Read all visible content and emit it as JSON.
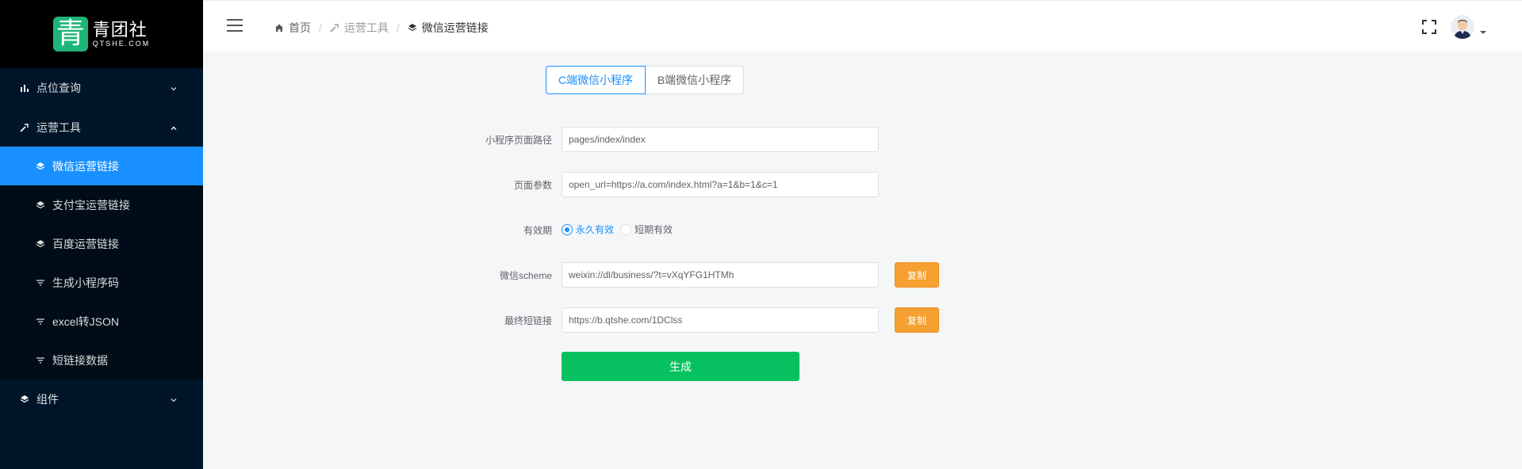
{
  "brand": {
    "name_cn": "青团社",
    "name_en": "QTSHE.COM",
    "mark": "青"
  },
  "sidebar": {
    "items": [
      {
        "label": "点位查询",
        "icon": "bar-chart-icon",
        "type": "group",
        "expanded": false
      },
      {
        "label": "运营工具",
        "icon": "tool-icon",
        "type": "group",
        "expanded": true
      },
      {
        "label": "微信运营链接",
        "icon": "layers-icon",
        "type": "sub",
        "active": true
      },
      {
        "label": "支付宝运营链接",
        "icon": "layers-icon",
        "type": "sub"
      },
      {
        "label": "百度运营链接",
        "icon": "layers-icon",
        "type": "sub"
      },
      {
        "label": "生成小程序码",
        "icon": "filter-icon",
        "type": "sub"
      },
      {
        "label": "excel转JSON",
        "icon": "filter-icon",
        "type": "sub"
      },
      {
        "label": "短链接数据",
        "icon": "filter-icon",
        "type": "sub"
      },
      {
        "label": "组件",
        "icon": "layers-icon",
        "type": "group",
        "expanded": false
      }
    ]
  },
  "breadcrumb": {
    "home": "首页",
    "section": "运营工具",
    "current": "微信运营链接"
  },
  "tabs": {
    "c": "C端微信小程序",
    "b": "B端微信小程序",
    "active": "c"
  },
  "form": {
    "path_label": "小程序页面路径",
    "path_value": "pages/index/index",
    "params_label": "页面参数",
    "params_value": "open_url=https://a.com/index.html?a=1&b=1&c=1",
    "validity_label": "有效期",
    "validity_options": [
      "永久有效",
      "短期有效"
    ],
    "validity_selected": "永久有效",
    "scheme_label": "微信scheme",
    "scheme_value": "weixin://dl/business/?t=vXqYFG1HTMh",
    "short_label": "最终短链接",
    "short_value": "https://b.qtshe.com/1DClss",
    "copy_label": "复制",
    "generate_label": "生成"
  },
  "colors": {
    "sidebar_bg": "#001529",
    "active": "#1890ff",
    "copy": "#f5a031",
    "generate": "#07c160",
    "brand": "#1fb57a"
  }
}
